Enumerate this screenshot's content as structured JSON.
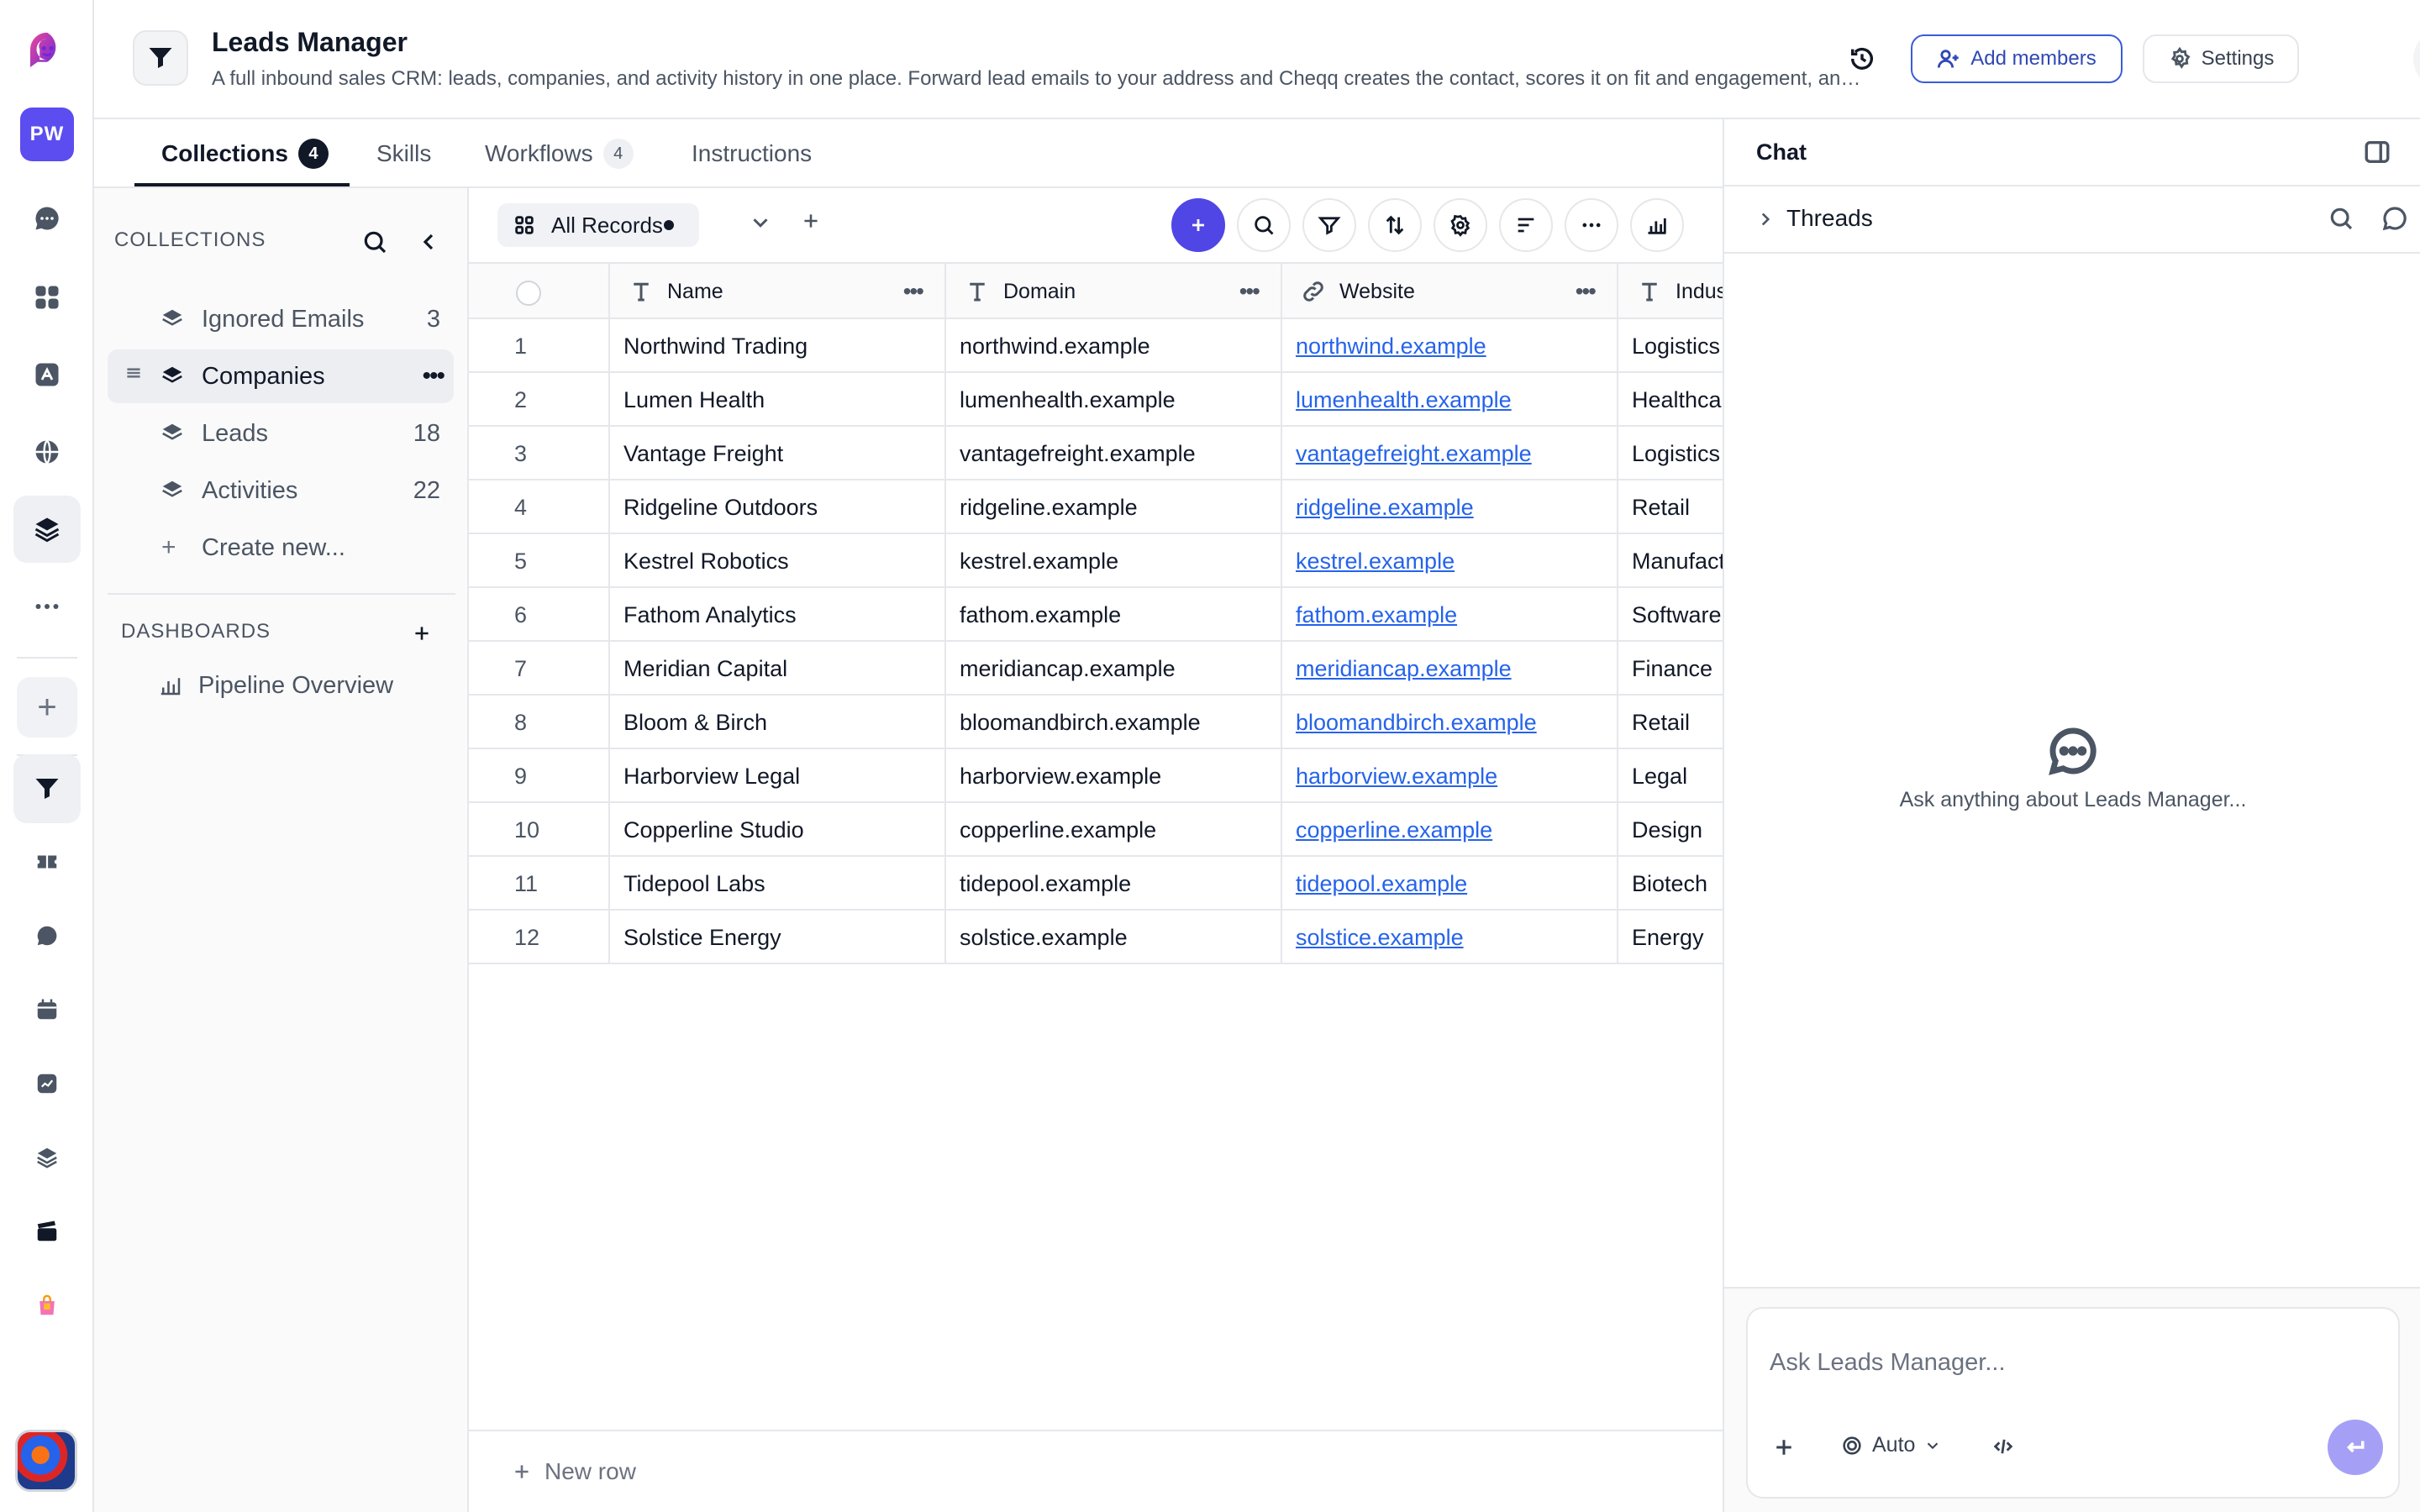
{
  "rail": {
    "workspace_initials": "PW",
    "icons": [
      "app-logo-icon",
      "chat-bubble-icon",
      "apps-grid-icon",
      "pdf-icon",
      "globe-icon",
      "layers-icon",
      "more-icon",
      "plus-icon",
      "funnel-icon",
      "ticket-icon",
      "message-icon",
      "calendar-icon",
      "chart-icon",
      "stack-icon",
      "clapper-icon",
      "shopping-bag-icon",
      "user-avatar"
    ]
  },
  "header": {
    "title": "Leads Manager",
    "description": "A full inbound sales CRM: leads, companies, and activity history in one place. Forward lead emails to your address and Cheqq creates the contact, scores it on fit and engagement, and logs every touchpoint.",
    "add_members_label": "Add members",
    "settings_label": "Settings"
  },
  "tabs": [
    {
      "label": "Collections",
      "badge": "4",
      "active": true
    },
    {
      "label": "Skills",
      "badge": null,
      "active": false
    },
    {
      "label": "Workflows",
      "badge": "4",
      "active": false
    },
    {
      "label": "Instructions",
      "badge": null,
      "active": false
    }
  ],
  "sidebar": {
    "collections_heading": "COLLECTIONS",
    "collections": [
      {
        "label": "Ignored Emails",
        "count": "3"
      },
      {
        "label": "Companies",
        "count": "",
        "active": true
      },
      {
        "label": "Leads",
        "count": "18"
      },
      {
        "label": "Activities",
        "count": "22"
      }
    ],
    "create_new_label": "Create new...",
    "dashboards_heading": "DASHBOARDS",
    "dashboards": [
      {
        "label": "Pipeline Overview"
      }
    ]
  },
  "toolbar": {
    "view_label": "All Records"
  },
  "table": {
    "columns": [
      {
        "name": "Name",
        "type": "text"
      },
      {
        "name": "Domain",
        "type": "text"
      },
      {
        "name": "Website",
        "type": "link"
      },
      {
        "name": "Industry",
        "type": "text"
      }
    ],
    "rows": [
      {
        "n": "1",
        "name": "Northwind Trading",
        "domain": "northwind.example",
        "website": "northwind.example",
        "industry": "Logistics"
      },
      {
        "n": "2",
        "name": "Lumen Health",
        "domain": "lumenhealth.example",
        "website": "lumenhealth.example",
        "industry": "Healthcare"
      },
      {
        "n": "3",
        "name": "Vantage Freight",
        "domain": "vantagefreight.example",
        "website": "vantagefreight.example",
        "industry": "Logistics"
      },
      {
        "n": "4",
        "name": "Ridgeline Outdoors",
        "domain": "ridgeline.example",
        "website": "ridgeline.example",
        "industry": "Retail"
      },
      {
        "n": "5",
        "name": "Kestrel Robotics",
        "domain": "kestrel.example",
        "website": "kestrel.example",
        "industry": "Manufacturing"
      },
      {
        "n": "6",
        "name": "Fathom Analytics",
        "domain": "fathom.example",
        "website": "fathom.example",
        "industry": "Software"
      },
      {
        "n": "7",
        "name": "Meridian Capital",
        "domain": "meridiancap.example",
        "website": "meridiancap.example",
        "industry": "Finance"
      },
      {
        "n": "8",
        "name": "Bloom & Birch",
        "domain": "bloomandbirch.example",
        "website": "bloomandbirch.example",
        "industry": "Retail"
      },
      {
        "n": "9",
        "name": "Harborview Legal",
        "domain": "harborview.example",
        "website": "harborview.example",
        "industry": "Legal"
      },
      {
        "n": "10",
        "name": "Copperline Studio",
        "domain": "copperline.example",
        "website": "copperline.example",
        "industry": "Design"
      },
      {
        "n": "11",
        "name": "Tidepool Labs",
        "domain": "tidepool.example",
        "website": "tidepool.example",
        "industry": "Biotech"
      },
      {
        "n": "12",
        "name": "Solstice Energy",
        "domain": "solstice.example",
        "website": "solstice.example",
        "industry": "Energy"
      }
    ],
    "new_row_label": "New row"
  },
  "chat": {
    "title": "Chat",
    "threads_label": "Threads",
    "empty_text": "Ask anything about Leads Manager...",
    "input_placeholder": "Ask Leads Manager...",
    "model_label": "Auto"
  },
  "colors": {
    "accent": "#4f46e5",
    "workspace_badge": "#5b4df0",
    "link": "#2563eb",
    "add_members_border": "#3b5bdb"
  }
}
